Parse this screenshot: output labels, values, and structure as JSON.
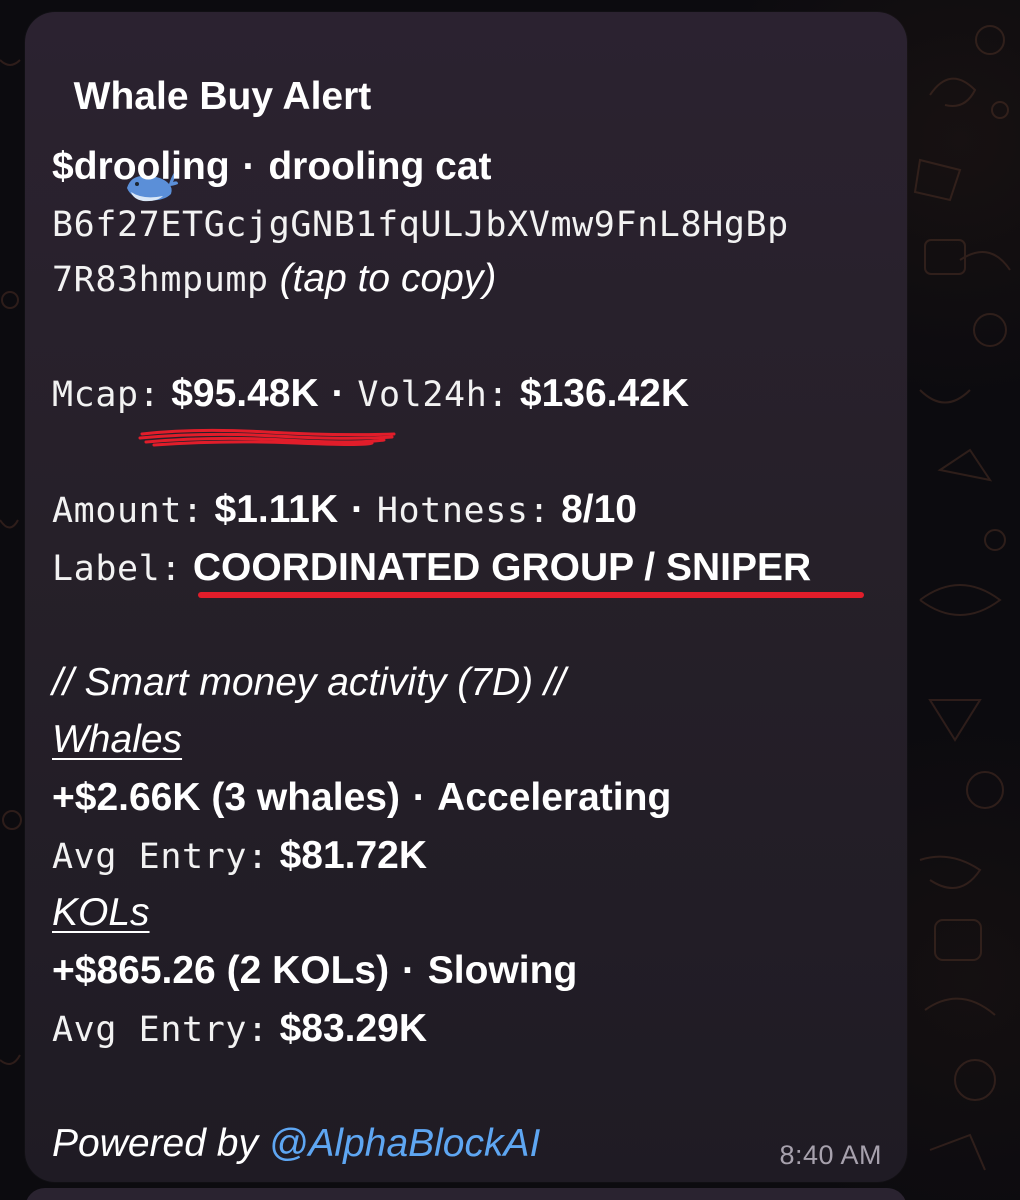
{
  "alert": {
    "title": "Whale Buy Alert",
    "title_icon": "whale-icon",
    "ticker": "$drooling",
    "separator": "·",
    "token_name": "drooling cat",
    "address_line1": "B6f27ETGcjgGNB1fqULJbXVmw9FnL8HgBp",
    "address_line2": "7R83hmpump",
    "copy_hint": "(tap to copy)"
  },
  "stats": {
    "mcap_label": "Mcap:",
    "mcap_value": "$95.48K",
    "vol_label": "Vol24h:",
    "vol_value": "$136.42K",
    "amount_label": "Amount:",
    "amount_value": "$1.11K",
    "hotness_label": "Hotness:",
    "hotness_value": "8/10",
    "label_label": "Label:",
    "label_value": "COORDINATED GROUP / SNIPER"
  },
  "smart_money": {
    "heading": "// Smart money activity (7D) //",
    "whales": {
      "title": "Whales",
      "flow": "+$2.66K (3 whales)",
      "trend": "Accelerating",
      "avg_label": "Avg Entry:",
      "avg_value": "$81.72K"
    },
    "kols": {
      "title": "KOLs",
      "flow": "+$865.26 (2 KOLs)",
      "trend": "Slowing",
      "avg_label": "Avg Entry:",
      "avg_value": "$83.29K"
    }
  },
  "footer": {
    "powered_by": "Powered by",
    "handle": "@AlphaBlockAI",
    "time": "8:40 AM"
  },
  "colors": {
    "bubble": "#2a2330",
    "text": "#ffffff",
    "link": "#5ea6f2",
    "annotation_red": "#e11d2a",
    "timestamp": "#a7a1ad"
  }
}
